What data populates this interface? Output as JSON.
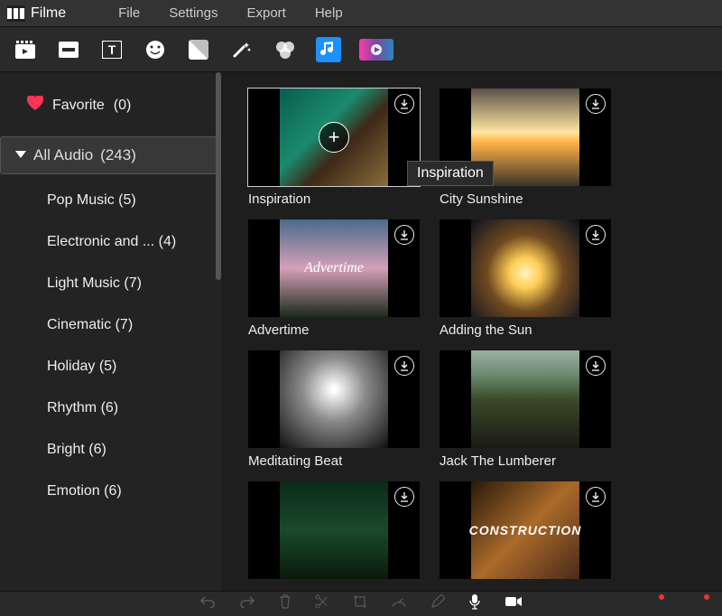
{
  "app": {
    "name": "Filme"
  },
  "menu": [
    "File",
    "Settings",
    "Export",
    "Help"
  ],
  "sidebar": {
    "favorite_label": "Favorite",
    "favorite_count": "(0)",
    "selected_label": "All Audio",
    "selected_count": "(243)",
    "categories": [
      {
        "label": "Pop Music",
        "count": "(5)"
      },
      {
        "label": "Electronic and ...",
        "count": "(4)"
      },
      {
        "label": "Light Music",
        "count": "(7)"
      },
      {
        "label": "Cinematic",
        "count": "(7)"
      },
      {
        "label": "Holiday",
        "count": "(5)"
      },
      {
        "label": "Rhythm",
        "count": "(6)"
      },
      {
        "label": "Bright",
        "count": "(6)"
      },
      {
        "label": "Emotion",
        "count": "(6)"
      }
    ]
  },
  "tooltip": "Inspiration",
  "cards": [
    {
      "label": "Inspiration",
      "overlay_text": ""
    },
    {
      "label": "City Sunshine",
      "overlay_text": ""
    },
    {
      "label": "Advertime",
      "overlay_text": "Advertime"
    },
    {
      "label": "Adding the Sun",
      "overlay_text": ""
    },
    {
      "label": "Meditating Beat",
      "overlay_text": ""
    },
    {
      "label": "Jack The Lumberer",
      "overlay_text": ""
    },
    {
      "label": "",
      "overlay_text": ""
    },
    {
      "label": "",
      "overlay_text": "CONSTRUCTION"
    }
  ]
}
